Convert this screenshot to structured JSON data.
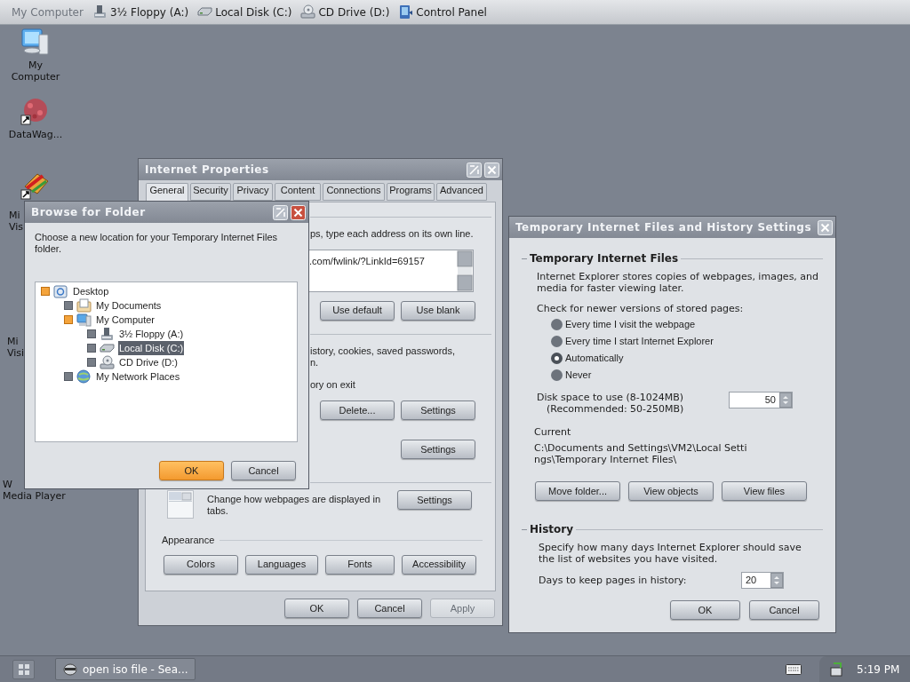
{
  "top_bar": [
    {
      "label": "My Computer",
      "selected": true
    },
    {
      "label": "3½ Floppy (A:)",
      "selected": false,
      "kind": "floppy"
    },
    {
      "label": "Local Disk (C:)",
      "selected": false,
      "kind": "disk"
    },
    {
      "label": "CD Drive (D:)",
      "selected": false,
      "kind": "cd"
    },
    {
      "label": "Control Panel",
      "selected": false,
      "kind": "panel"
    }
  ],
  "desktop_icons": [
    {
      "label": "My Computer",
      "kind": "computer"
    },
    {
      "label": "DataWag...",
      "kind": "burst"
    },
    {
      "label": "Mi\nVis",
      "kind": "tool"
    },
    {
      "label": "Mi\nVisi"
    },
    {
      "label": "W\nMedia Player"
    }
  ],
  "internet_properties": {
    "title": "Internet Properties",
    "tabs": [
      {
        "label": "General",
        "selected": true
      },
      {
        "label": "Security",
        "selected": false
      },
      {
        "label": "Privacy",
        "selected": false
      },
      {
        "label": "Content",
        "selected": false
      },
      {
        "label": "Connections",
        "selected": false
      },
      {
        "label": "Programs",
        "selected": false
      },
      {
        "label": "Advanced",
        "selected": false
      }
    ],
    "home_text": "ps, type each address on its own line.",
    "home_url": ".com/fwlink/?LinkId=69157",
    "home_buttons": [
      "Use default",
      "Use blank"
    ],
    "history_text": "istory, cookies, saved passwords,\nn.",
    "history_exit_text": "ory on exit",
    "history_buttons": [
      "Delete...",
      "Settings"
    ],
    "search_button": "Settings",
    "tabs_text": "Change how webpages are displayed in tabs.",
    "tabs_button": "Settings",
    "appearance_label": "Appearance",
    "appearance_buttons": [
      "Colors",
      "Languages",
      "Fonts",
      "Accessibility"
    ],
    "footer_buttons": [
      {
        "label": "OK",
        "disabled": false
      },
      {
        "label": "Cancel",
        "disabled": false
      },
      {
        "label": "Apply",
        "disabled": true
      }
    ]
  },
  "browse_folder": {
    "title": "Browse for Folder",
    "prompt": "Choose a new location for your Temporary Internet Files folder.",
    "tree": [
      {
        "label": "Desktop",
        "kind": "desktop",
        "expanded": true,
        "selected": false,
        "children": [
          {
            "label": "My Documents",
            "kind": "documents",
            "expanded": false,
            "selected": false
          },
          {
            "label": "My Computer",
            "kind": "computer",
            "expanded": true,
            "selected": false,
            "children": [
              {
                "label": "3½ Floppy (A:)",
                "kind": "floppy",
                "expanded": false,
                "selected": false
              },
              {
                "label": "Local Disk (C:)",
                "kind": "disk",
                "expanded": false,
                "selected": true
              },
              {
                "label": "CD Drive (D:)",
                "kind": "cd",
                "expanded": false,
                "selected": false
              }
            ]
          },
          {
            "label": "My Network Places",
            "kind": "network",
            "expanded": false,
            "selected": false
          }
        ]
      }
    ],
    "buttons": [
      {
        "label": "OK",
        "default": true
      },
      {
        "label": "Cancel",
        "default": false
      }
    ]
  },
  "temp_files": {
    "title": "Temporary Internet Files and History Settings",
    "files_heading": "Temporary Internet Files",
    "files_description": "Internet Explorer stores copies of webpages, images, and media for faster viewing later.",
    "check_label": "Check for newer versions of stored pages:",
    "options": [
      {
        "label": "Every time I visit the webpage",
        "selected": false
      },
      {
        "label": "Every time I start Internet Explorer",
        "selected": false
      },
      {
        "label": "Automatically",
        "selected": true
      },
      {
        "label": "Never",
        "selected": false
      }
    ],
    "disk_label": "Disk space to use (8-1024MB)",
    "disk_recommended": "(Recommended: 50-250MB)",
    "disk_value": "50",
    "current_label": "Current",
    "current_path": "C:\\Documents and Settings\\VM2\\Local Settings\\Temporary Internet Files\\",
    "folder_buttons": [
      "Move folder...",
      "View objects",
      "View files"
    ],
    "history_heading": "History",
    "history_description": "Specify how many days Internet Explorer should save the list of websites you have visited.",
    "days_label": "Days to keep pages in history:",
    "days_value": "20",
    "buttons": [
      "OK",
      "Cancel"
    ]
  },
  "taskbar": {
    "tasks": [
      {
        "label": "open iso file - Sea..."
      }
    ],
    "clock": "5:19 PM"
  }
}
